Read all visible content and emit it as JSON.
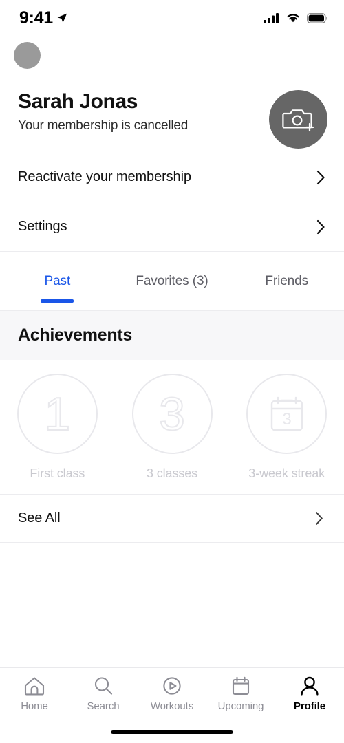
{
  "status_bar": {
    "time": "9:41",
    "location_icon": "location-arrow-icon",
    "signal_icon": "cellular-signal-icon",
    "wifi_icon": "wifi-icon",
    "battery_icon": "battery-full-icon"
  },
  "profile": {
    "avatar_icon": "avatar-placeholder",
    "name": "Sarah Jonas",
    "membership_status": "Your membership is cancelled",
    "camera_button_icon": "camera-add-icon",
    "camera_button_color": "#666666"
  },
  "menu": {
    "items": [
      {
        "label": "Reactivate your membership",
        "chevron": "chevron-right-icon"
      },
      {
        "label": "Settings",
        "chevron": "chevron-right-icon"
      }
    ]
  },
  "tabs": {
    "accent_color": "#1a56e8",
    "items": [
      {
        "label": "Past",
        "active": true
      },
      {
        "label": "Favorites (3)",
        "active": false
      },
      {
        "label": "Friends",
        "active": false
      }
    ]
  },
  "achievements": {
    "heading": "Achievements",
    "header_background": "#f7f7f9",
    "badges": [
      {
        "glyph": "1",
        "icon": "number-one-badge-icon",
        "label": "First class",
        "locked": true
      },
      {
        "glyph": "3",
        "icon": "number-three-badge-icon",
        "label": "3 classes",
        "locked": true
      },
      {
        "glyph": "3",
        "icon": "calendar-streak-icon",
        "label": "3-week streak",
        "locked": true
      }
    ],
    "see_all": {
      "label": "See All",
      "chevron": "chevron-right-icon"
    }
  },
  "bottom_nav": {
    "items": [
      {
        "label": "Home",
        "icon": "home-icon",
        "active": false
      },
      {
        "label": "Search",
        "icon": "search-icon",
        "active": false
      },
      {
        "label": "Workouts",
        "icon": "play-circle-icon",
        "active": false
      },
      {
        "label": "Upcoming",
        "icon": "calendar-icon",
        "active": false
      },
      {
        "label": "Profile",
        "icon": "person-icon",
        "active": true
      }
    ]
  },
  "home_indicator": "home-indicator"
}
